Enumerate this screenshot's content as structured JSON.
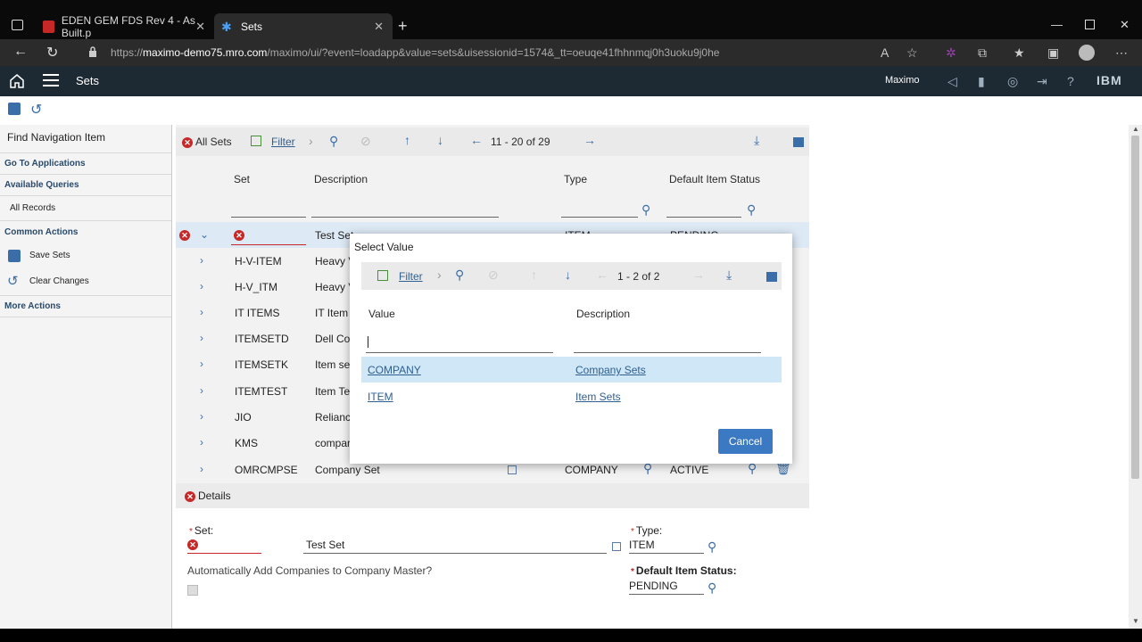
{
  "browser": {
    "tabs": [
      {
        "label": "EDEN GEM FDS Rev 4 - As Built.p"
      },
      {
        "label": "Sets"
      }
    ],
    "url_host": "maximo-demo75.mro.com",
    "url_prefix": "https://",
    "url_path": "/maximo/ui/?event=loadapp&value=sets&uisessionid=1574&_tt=oeuqe41fhhnmqj0h3uoku9j0he"
  },
  "app": {
    "title": "Sets",
    "user_label": "Maximo",
    "brand": "IBM"
  },
  "sidebar": {
    "find_label": "Find Navigation Item",
    "go_to_apps": "Go To Applications",
    "available_queries": "Available Queries",
    "all_records": "All Records",
    "common_actions": "Common Actions",
    "save_sets": "Save Sets",
    "clear_changes": "Clear Changes",
    "more_actions": "More Actions"
  },
  "list": {
    "all_sets": "All Sets",
    "filter": "Filter",
    "pager": "11 - 20 of 29",
    "columns": {
      "set": "Set",
      "description": "Description",
      "type": "Type",
      "default_status": "Default Item Status"
    },
    "rows": [
      {
        "set": "",
        "description": "Test Set",
        "type": "ITEM",
        "status": "PENDING"
      },
      {
        "set": "H-V-ITEM",
        "description": "Heavy V",
        "type": "",
        "status": ""
      },
      {
        "set": "H-V_ITM",
        "description": "Heavy V",
        "type": "",
        "status": ""
      },
      {
        "set": "IT ITEMS",
        "description": "IT Item",
        "type": "",
        "status": ""
      },
      {
        "set": "ITEMSETD",
        "description": "Dell Co",
        "type": "",
        "status": ""
      },
      {
        "set": "ITEMSETK",
        "description": "Item se",
        "type": "",
        "status": ""
      },
      {
        "set": "ITEMTEST",
        "description": "Item Te",
        "type": "",
        "status": ""
      },
      {
        "set": "JIO",
        "description": "Relianc",
        "type": "",
        "status": ""
      },
      {
        "set": "KMS",
        "description": "compar",
        "type": "",
        "status": ""
      },
      {
        "set": "OMRCMPSE",
        "description": "Company Set",
        "type": "COMPANY",
        "status": "ACTIVE"
      }
    ]
  },
  "details": {
    "header": "Details",
    "set_label": "Set:",
    "set_description": "Test Set",
    "type_label": "Type:",
    "type_value": "ITEM",
    "auto_add_label": "Automatically Add Companies to Company Master?",
    "default_status_label": "Default Item Status:",
    "default_status_value": "PENDING"
  },
  "dialog": {
    "title": "Select Value",
    "filter": "Filter",
    "pager": "1 - 2 of 2",
    "col_value": "Value",
    "col_description": "Description",
    "rows": [
      {
        "value": "COMPANY",
        "description": "Company Sets"
      },
      {
        "value": "ITEM",
        "description": "Item Sets"
      }
    ],
    "cancel": "Cancel"
  }
}
